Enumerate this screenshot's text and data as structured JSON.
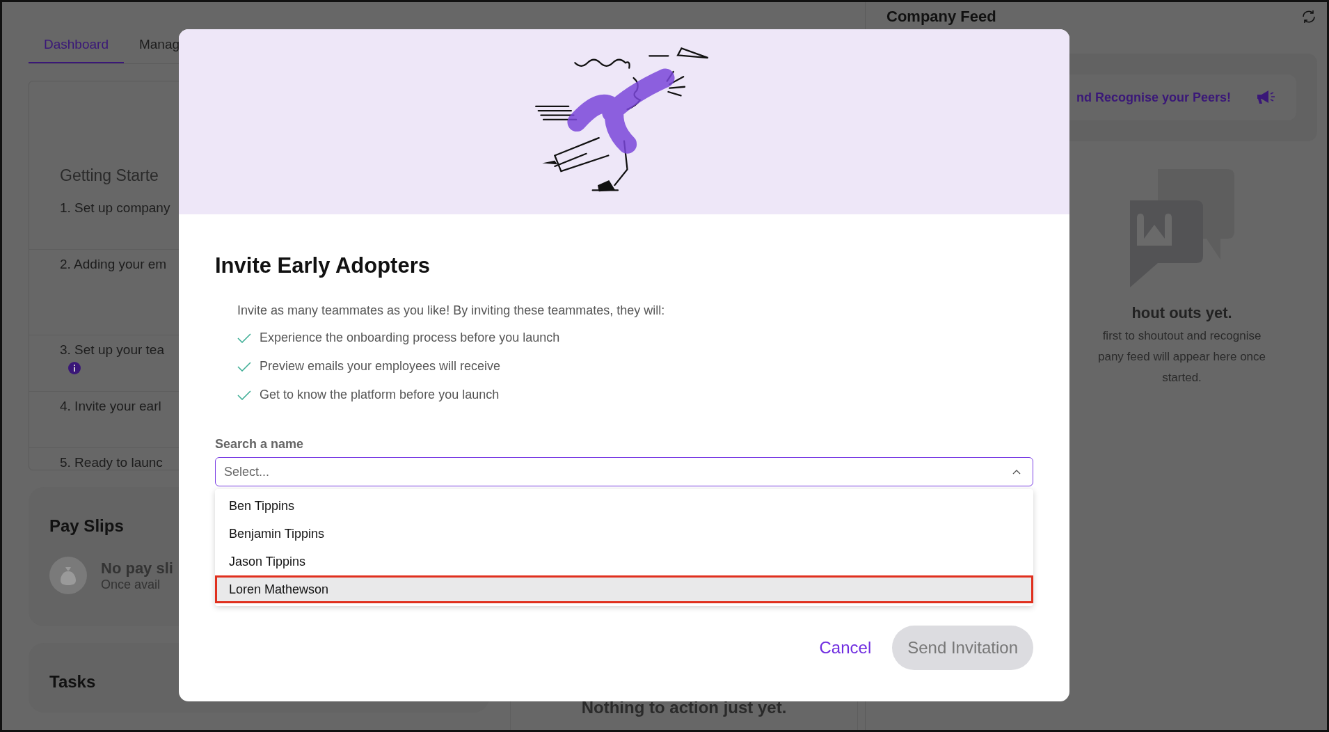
{
  "tabs": [
    {
      "label": "Dashboard",
      "selected": true
    },
    {
      "label": "Manag",
      "selected": false
    }
  ],
  "getting_started": {
    "title": "Getting Starte",
    "steps": [
      {
        "label": "1. Set up company",
        "info": false
      },
      {
        "label": "2. Adding your em",
        "info": false
      },
      {
        "label": "3. Set up your tea",
        "info": true
      },
      {
        "label": "4. Invite your earl",
        "info": false
      },
      {
        "label": "5. Ready to launc",
        "info": false
      }
    ]
  },
  "pay_slips": {
    "title": "Pay Slips",
    "empty_title": "No pay sli",
    "empty_text": "Once avail"
  },
  "tasks": {
    "title": "Tasks"
  },
  "middle_panel": {
    "empty_title": "Nothing to action just yet."
  },
  "company_feed": {
    "title": "Company Feed",
    "banner": "nd Recognise your Peers!",
    "empty_title": "hout outs yet.",
    "empty_lines": [
      "first to shoutout and recognise",
      "pany feed will appear here once",
      "started."
    ]
  },
  "modal": {
    "title": "Invite Early Adopters",
    "intro": "Invite as many teammates as you like! By inviting these teammates, they will:",
    "benefits": [
      "Experience the onboarding process before you launch",
      "Preview emails your employees will receive",
      "Get to know the platform before you launch"
    ],
    "search": {
      "label": "Search a name",
      "placeholder": "Select...",
      "expanded": true,
      "options": [
        {
          "label": "Ben Tippins",
          "selected": false
        },
        {
          "label": "Benjamin Tippins",
          "selected": false
        },
        {
          "label": "Jason Tippins",
          "selected": false
        },
        {
          "label": "Loren Mathewson",
          "selected": true
        }
      ]
    },
    "buttons": [
      {
        "label": "Cancel",
        "kind": "link",
        "disabled": false
      },
      {
        "label": "Send Invitation",
        "kind": "primary",
        "disabled": true
      }
    ]
  }
}
